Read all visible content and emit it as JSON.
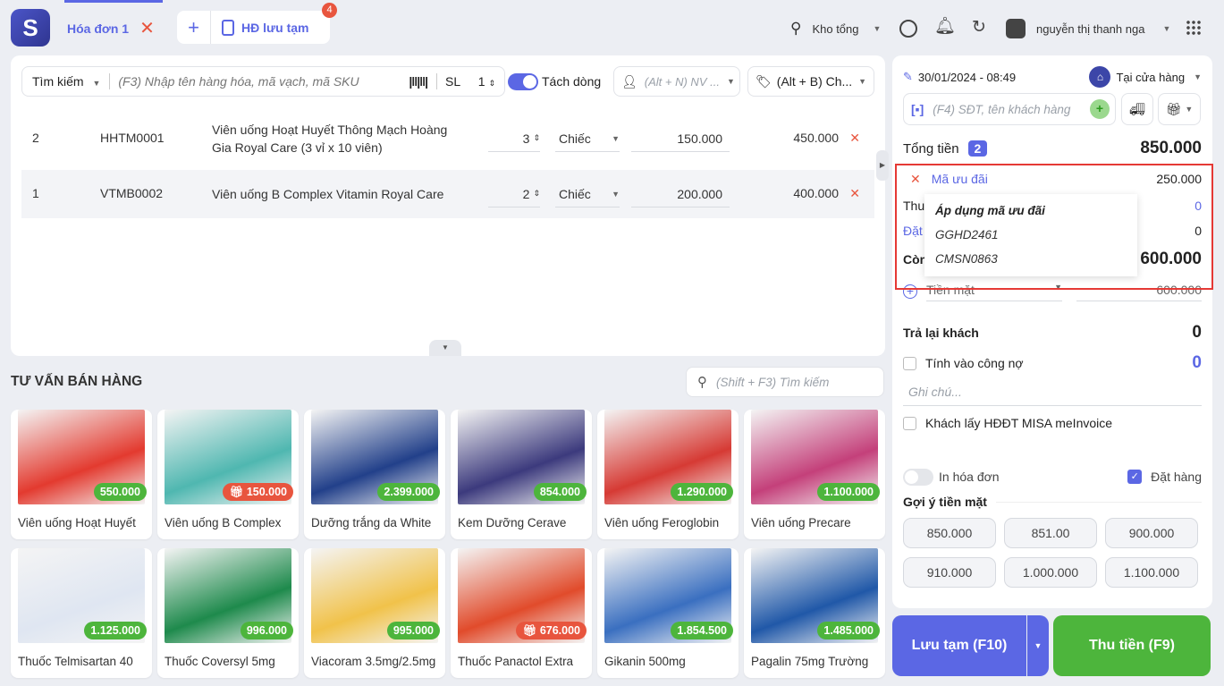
{
  "header": {
    "active_tab": "Hóa đơn 1",
    "saved_tab": "HĐ lưu tạm",
    "saved_count": "4",
    "warehouse": "Kho tổng",
    "user": "nguyễn thị thanh nga"
  },
  "search": {
    "mode": "Tìm kiếm",
    "placeholder": "(F3) Nhập tên hàng hóa, mã vạch, mã SKU",
    "qty_label": "SL",
    "qty": "1",
    "split_label": "Tách dòng",
    "staff_placeholder": "(Alt + N) NV ...",
    "price_list": "(Alt + B) Ch..."
  },
  "order_lines": [
    {
      "index": "2",
      "code": "HHTM0001",
      "name_l1": "Viên uống Hoạt Huyết Thông Mạch Hoàng",
      "name_l2": "Gia Royal Care (3 vỉ x 10 viên)",
      "qty": "3",
      "unit": "Chiếc",
      "price": "150.000",
      "total": "450.000"
    },
    {
      "index": "1",
      "code": "VTMB0002",
      "name_l1": "Viên uống B Complex Vitamin Royal Care",
      "name_l2": "",
      "qty": "2",
      "unit": "Chiếc",
      "price": "200.000",
      "total": "400.000"
    }
  ],
  "consult": {
    "title": "TƯ VẤN BÁN HÀNG",
    "search_placeholder": "(Shift + F3) Tìm kiếm"
  },
  "products": [
    {
      "name": "Viên uống Hoạt Huyết",
      "price": "550.000",
      "promo": false,
      "color": "#e33a2f"
    },
    {
      "name": "Viên uống B Complex",
      "price": "150.000",
      "promo": true,
      "color": "#4fb7b0"
    },
    {
      "name": "Dưỡng trắng da White",
      "price": "2.399.000",
      "promo": false,
      "color": "#22408a"
    },
    {
      "name": "Kem Dưỡng Cerave",
      "price": "854.000",
      "promo": false,
      "color": "#3c3a7d"
    },
    {
      "name": "Viên uống Feroglobin",
      "price": "1.290.000",
      "promo": false,
      "color": "#d63a34"
    },
    {
      "name": "Viên uống Precare",
      "price": "1.100.000",
      "promo": false,
      "color": "#c4407a"
    },
    {
      "name": "Thuốc Telmisartan 40",
      "price": "1.125.000",
      "promo": false,
      "color": "#dfe6f2"
    },
    {
      "name": "Thuốc Coversyl 5mg",
      "price": "996.000",
      "promo": false,
      "color": "#1e8a4c"
    },
    {
      "name": "Viacoram 3.5mg/2.5mg",
      "price": "995.000",
      "promo": false,
      "color": "#f1c24a"
    },
    {
      "name": "Thuốc Panactol Extra",
      "price": "676.000",
      "promo": true,
      "color": "#e14b2b"
    },
    {
      "name": "Gikanin 500mg",
      "price": "1.854.500",
      "promo": false,
      "color": "#3a6fc0"
    },
    {
      "name": "Pagalin 75mg Trường",
      "price": "1.485.000",
      "promo": false,
      "color": "#2058a8"
    }
  ],
  "invoice": {
    "datetime": "30/01/2024 - 08:49",
    "channel": "Tại cửa hàng",
    "customer_placeholder": "(F4) SĐT, tên khách hàng",
    "total_label": "Tổng tiền",
    "total_count": "2",
    "total": "850.000",
    "discount_label": "Mã ưu đãi",
    "discount": "250.000",
    "other_label": "Thu",
    "other": "0",
    "deposit_label": "Đặt",
    "deposit": "0",
    "remain_label": "Còn",
    "remain": "600.000",
    "payment_method": "Tiền mặt",
    "payment_amount": "600.000",
    "change_label": "Trả lại khách",
    "change": "0",
    "debt_label": "Tính vào công nợ",
    "debt": "0",
    "note_placeholder": "Ghi chú...",
    "einvoice_label": "Khách lấy HĐĐT MISA meInvoice",
    "print_label": "In hóa đơn",
    "order_label": "Đặt hàng",
    "suggest_label": "Gợi ý tiền mặt",
    "suggestions": [
      "850.000",
      "851.00",
      "900.000",
      "910.000",
      "1.000.000",
      "1.100.000"
    ],
    "save_button": "Lưu tạm (F10)",
    "pay_button": "Thu tiền (F9)"
  },
  "popup": {
    "title": "Áp dụng mã ưu đãi",
    "codes": [
      "GGHD2461",
      "CMSN0863"
    ]
  },
  "colors": {
    "accent": "#5b67e4",
    "green": "#4db53c",
    "red": "#e8553e",
    "highlight_border": "#e53935"
  }
}
